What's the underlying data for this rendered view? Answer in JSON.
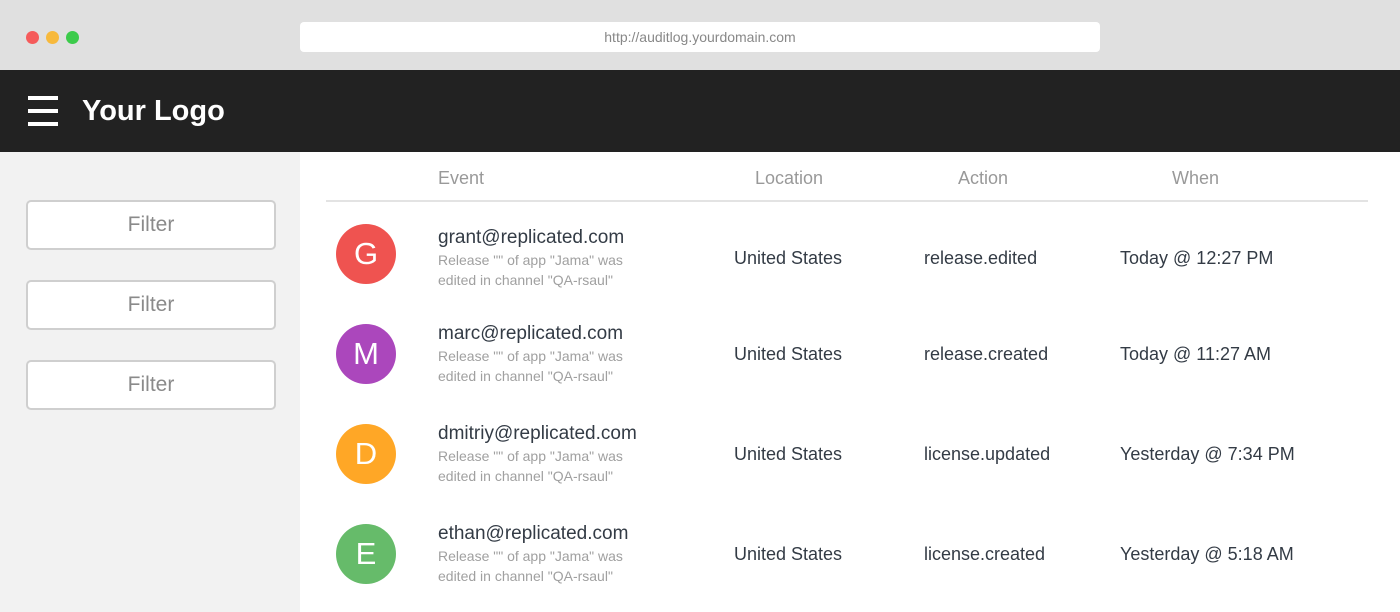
{
  "browser": {
    "url": "http://auditlog.yourdomain.com"
  },
  "header": {
    "menu_icon": "hamburger-menu-icon",
    "logo_text": "Your Logo"
  },
  "sidebar": {
    "filters": [
      {
        "label": "Filter"
      },
      {
        "label": "Filter"
      },
      {
        "label": "Filter"
      }
    ]
  },
  "table": {
    "columns": {
      "event": "Event",
      "location": "Location",
      "action": "Action",
      "when": "When"
    },
    "rows": [
      {
        "initial": "G",
        "avatar_color": "#ef5350",
        "email": "grant@replicated.com",
        "description": "Release \"\" of app \"Jama\" was edited in channel \"QA-rsaul\"",
        "location": "United States",
        "action": "release.edited",
        "when": "Today @ 12:27 PM"
      },
      {
        "initial": "M",
        "avatar_color": "#ab47bc",
        "email": "marc@replicated.com",
        "description": "Release \"\" of app \"Jama\" was edited in channel \"QA-rsaul\"",
        "location": "United States",
        "action": "release.created",
        "when": "Today @ 11:27 AM"
      },
      {
        "initial": "D",
        "avatar_color": "#ffa726",
        "email": "dmitriy@replicated.com",
        "description": "Release \"\" of app \"Jama\" was edited in channel \"QA-rsaul\"",
        "location": "United States",
        "action": "license.updated",
        "when": "Yesterday @ 7:34 PM"
      },
      {
        "initial": "E",
        "avatar_color": "#66bb6a",
        "email": "ethan@replicated.com",
        "description": "Release \"\" of app \"Jama\" was edited in channel \"QA-rsaul\"",
        "location": "United States",
        "action": "license.created",
        "when": "Yesterday @ 5:18 AM"
      }
    ]
  }
}
